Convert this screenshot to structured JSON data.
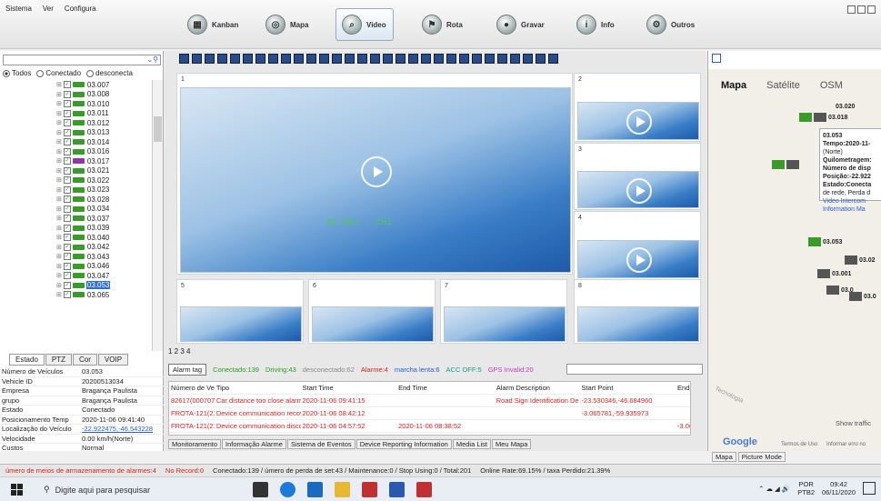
{
  "menu": [
    "Sistema",
    "Ver",
    "Configura"
  ],
  "nav": [
    {
      "label": "Kanban",
      "icon": "kanban-icon"
    },
    {
      "label": "Mapa",
      "icon": "map-icon"
    },
    {
      "label": "Video",
      "icon": "video-icon"
    },
    {
      "label": "Rota",
      "icon": "route-icon"
    },
    {
      "label": "Gravar",
      "icon": "record-icon"
    },
    {
      "label": "Info",
      "icon": "info-icon"
    },
    {
      "label": "Outros",
      "icon": "others-icon"
    }
  ],
  "filters": {
    "all": "Todos",
    "connected": "Conectado",
    "disconnected": "desconecta"
  },
  "tree": [
    "03.007",
    "03.008",
    "03.010",
    "03.011",
    "03.012",
    "03.013",
    "03.014",
    "03.016",
    "03.017",
    "03.021",
    "03.022",
    "03.023",
    "03.028",
    "03.034",
    "03.037",
    "03.039",
    "03.040",
    "03.042",
    "03.043",
    "03.046",
    "03.047",
    "03.053",
    "03.065"
  ],
  "left_tabs": [
    "Estado",
    "PTZ",
    "Cor",
    "VOIP"
  ],
  "info": [
    {
      "k": "Número de Veículos",
      "v": "03.053"
    },
    {
      "k": "Vehicle ID",
      "v": "20200513034"
    },
    {
      "k": "Empresa",
      "v": "Bragança Paulista"
    },
    {
      "k": "grupo",
      "v": "Bragança Paulista"
    },
    {
      "k": "Estado",
      "v": "Conectado"
    },
    {
      "k": "Posicionamento Temp",
      "v": "2020-11-06 09:41:40"
    },
    {
      "k": "Localização do Veículo",
      "v": "-22.922475,-46.543228"
    },
    {
      "k": "Velocidade",
      "v": "0.00 km/h(Norte)"
    },
    {
      "k": "Custos",
      "v": "Normal"
    }
  ],
  "video": {
    "windows": [
      "1",
      "2",
      "3",
      "4",
      "5",
      "6",
      "7",
      "8"
    ],
    "channel_label": "02.091 - CH1"
  },
  "page_tabs": "1 2 3 4",
  "alarm": {
    "tag": "Alarm tag",
    "connected": "Conectado:139",
    "driving": "Driving:43",
    "disconnected": "desconectado:62",
    "alarme": "Alarme:4",
    "marcha": "marcha lenta:6",
    "acc": "ACC OFF:5",
    "gps": "GPS Invalid:20"
  },
  "table": {
    "headers": [
      "Número de Veíc",
      "Tipo",
      "Start Time",
      "End Time",
      "Alarm Description",
      "Start Point",
      "End"
    ],
    "rows": [
      [
        "82617(000707",
        "Car distance too close alarm Le",
        "2020-11-06 09:41:15",
        "",
        "Road Sign Identification De",
        "-23.530346,-46.684960",
        ""
      ],
      [
        "FROTA-121(21",
        "Device communication recover",
        "2020-11-06 08:42:12",
        "",
        "",
        "-3.065781,-59.935973",
        ""
      ],
      [
        "FROTA-121(21",
        "Device communication disconn",
        "2020-11-06 04:57:52",
        "2020-11-06 08:38:52",
        "",
        "",
        "-3.06"
      ]
    ]
  },
  "bottom_tabs": [
    "Monitoramento",
    "Informação Alarme",
    "Sistema de Eventos",
    "Device Reporting Information",
    "Media List",
    "Meu Mapa"
  ],
  "map": {
    "types": [
      "Mapa",
      "Satélite",
      "OSM"
    ],
    "popup": [
      "03.053",
      "Tempo:2020-11-",
      "(Norte)",
      "Quilometragem:",
      "Número de disp",
      "Posição:-22.922",
      "Estado:Conecta",
      "de rede, Perda d",
      "Video Intercom",
      "Information Ma"
    ],
    "vehicles": [
      "03.020",
      "03.018",
      "03.053",
      "03.001",
      "03.02",
      "03.0",
      "03.0"
    ],
    "show_traffic": "Show traffic",
    "google": "Google",
    "terms": "Termos de Uso",
    "report": "Informar erro no",
    "street": "Tecnologia",
    "tabs": [
      "Mapa",
      "Picture Mode"
    ]
  },
  "status": {
    "alarms": "úmero de meios de armazenamento de alarmes:4",
    "norecord": "No Record:0",
    "summary": "Conectado:139 / úmero de perda de set:43 / Maintenance:0 / Stop Using:0 / Total:201",
    "rate": "Online Rate:69.15% / taxa Perdido:21.39%"
  },
  "taskbar": {
    "search": "Digite aqui para pesquisar",
    "lang": "POR",
    "layout": "PTB2",
    "time": "09:42",
    "date": "06/11/2020"
  }
}
